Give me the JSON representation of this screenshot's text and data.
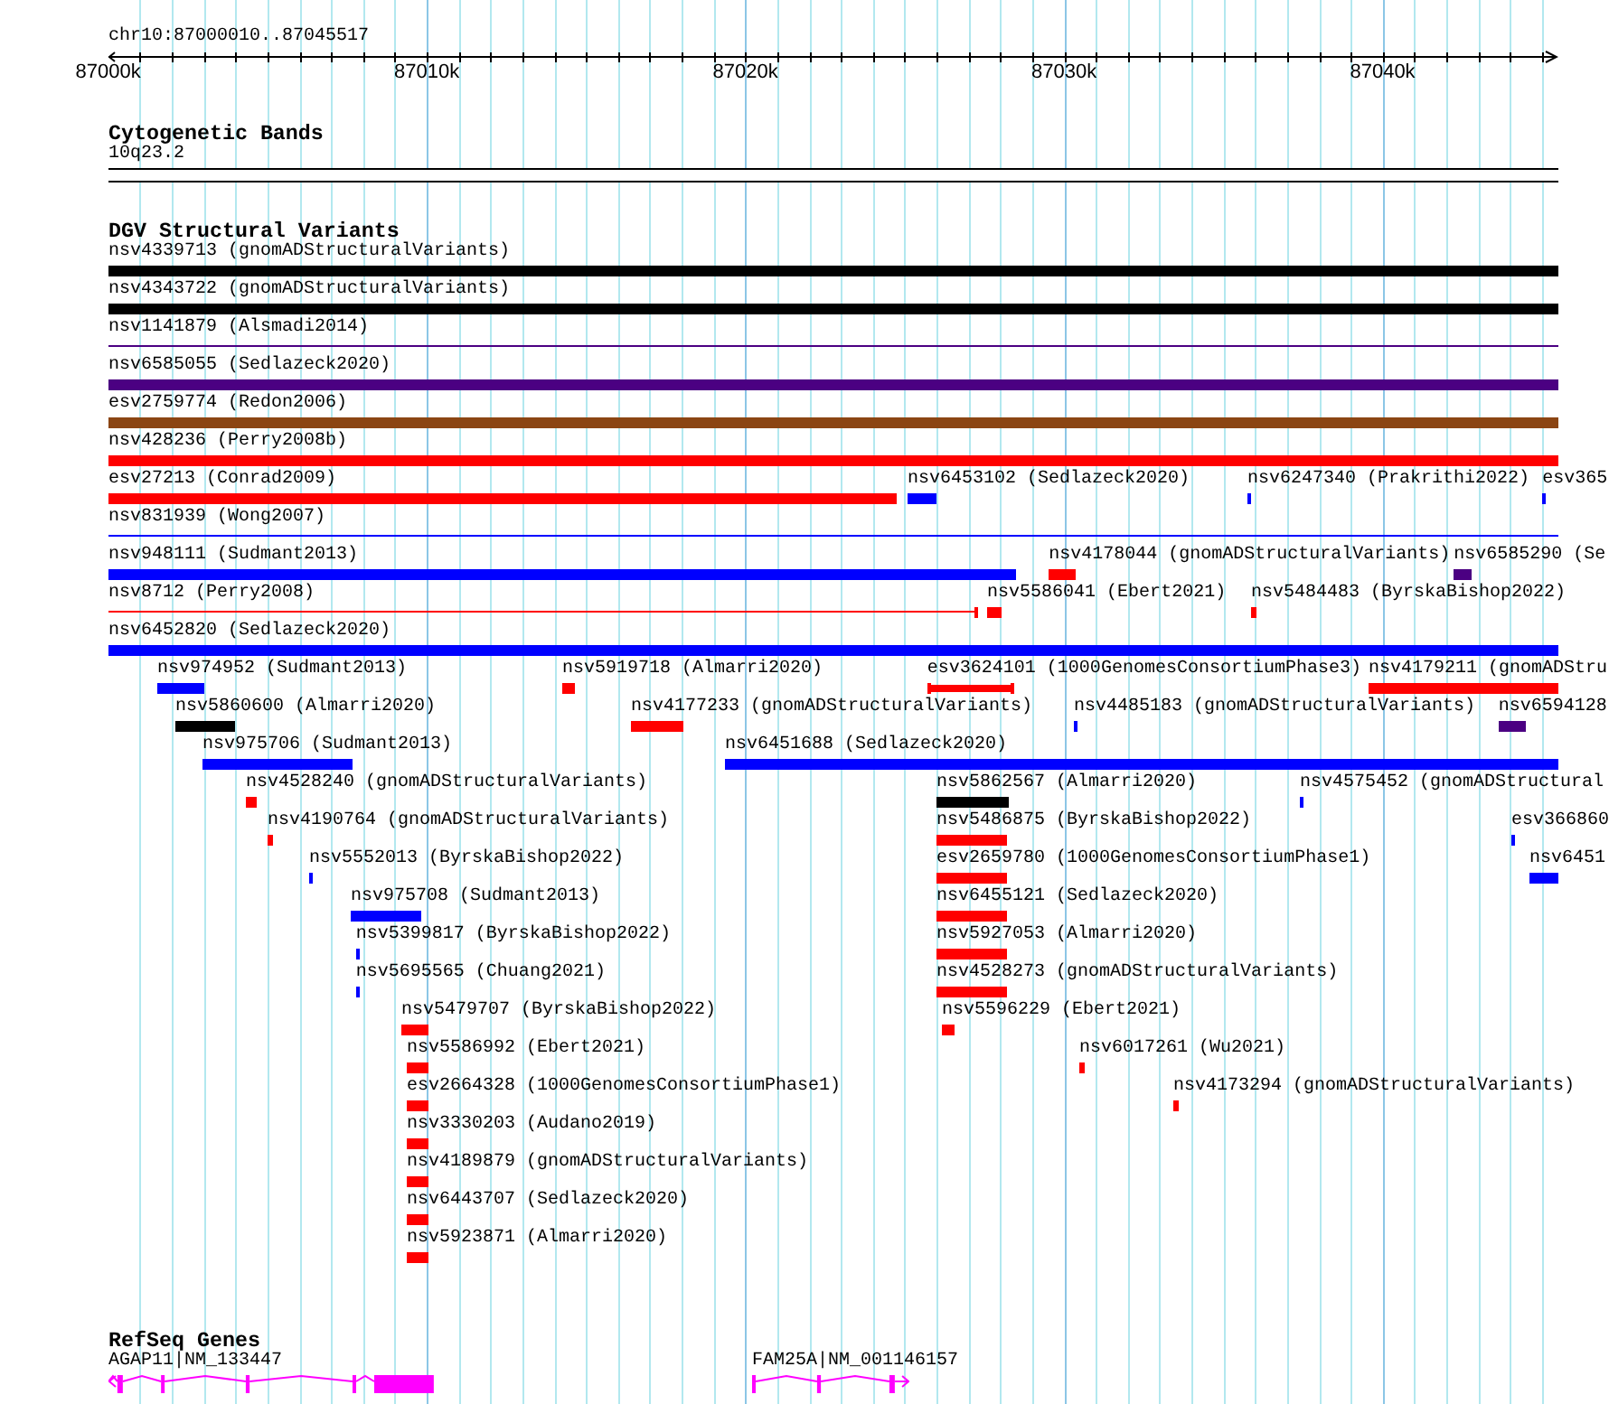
{
  "ruler": {
    "location": "chr10:87000010..87045517",
    "ticks": [
      "87000k",
      "87010k",
      "87020k",
      "87030k",
      "87040k"
    ]
  },
  "tracks": [
    {
      "kind": "cytoband",
      "title": "Cytogenetic Bands",
      "bands": [
        {
          "label": "10q23.2"
        }
      ]
    },
    {
      "kind": "variants",
      "title": "DGV Structural Variants",
      "rows": [
        {
          "features": [
            {
              "label": "nsv4339713 (gnomADStructuralVariants)",
              "color": "#000000",
              "kind": "bar"
            }
          ]
        },
        {
          "features": [
            {
              "label": "nsv4343722 (gnomADStructuralVariants)",
              "color": "#000000",
              "kind": "bar"
            }
          ]
        },
        {
          "features": [
            {
              "label": "nsv1141879 (Alsmadi2014)",
              "color": "#4b0082",
              "kind": "line"
            }
          ]
        },
        {
          "features": [
            {
              "label": "nsv6585055 (Sedlazeck2020)",
              "color": "#4b0082",
              "kind": "bar"
            }
          ]
        },
        {
          "features": [
            {
              "label": "esv2759774 (Redon2006)",
              "color": "#8b4513",
              "kind": "bar"
            }
          ]
        },
        {
          "features": [
            {
              "label": "nsv428236 (Perry2008b)",
              "color": "#ff0000",
              "kind": "bar"
            }
          ]
        },
        {
          "features": [
            {
              "label": "esv27213 (Conrad2009)",
              "color": "#ff0000",
              "kind": "bar"
            },
            {
              "label": "nsv6453102 (Sedlazeck2020)",
              "color": "#0000ff",
              "kind": "bar"
            },
            {
              "label": "nsv6247340 (Prakrithi2022)",
              "color": "#0000ff",
              "kind": "bar"
            },
            {
              "label": "esv365",
              "color": "#0000ff",
              "kind": "bar"
            }
          ]
        },
        {
          "features": [
            {
              "label": "nsv831939 (Wong2007)",
              "color": "#0000ff",
              "kind": "line"
            }
          ]
        },
        {
          "features": [
            {
              "label": "nsv948111 (Sudmant2013)",
              "color": "#0000ff",
              "kind": "bar"
            },
            {
              "label": "nsv4178044 (gnomADStructuralVariants)",
              "color": "#ff0000",
              "kind": "bar"
            },
            {
              "label": "nsv6585290 (Se",
              "color": "#4b0082",
              "kind": "bar"
            }
          ]
        },
        {
          "features": [
            {
              "label": "nsv8712 (Perry2008)",
              "color": "#ff0000",
              "kind": "line"
            },
            {
              "label": "nsv5586041 (Ebert2021)",
              "color": "#ff0000",
              "kind": "bar"
            },
            {
              "label": "nsv5484483 (ByrskaBishop2022)",
              "color": "#ff0000",
              "kind": "bar"
            }
          ]
        },
        {
          "features": [
            {
              "label": "nsv6452820 (Sedlazeck2020)",
              "color": "#0000ff",
              "kind": "bar"
            }
          ]
        },
        {
          "features": [
            {
              "label": "nsv974952 (Sudmant2013)",
              "color": "#0000ff",
              "kind": "bar"
            },
            {
              "label": "nsv5919718 (Almarri2020)",
              "color": "#ff0000",
              "kind": "bar"
            },
            {
              "label": "esv3624101 (1000GenomesConsortiumPhase3)",
              "color": "#ff0000",
              "kind": "capped"
            },
            {
              "label": "nsv4179211 (gnomADStru",
              "color": "#ff0000",
              "kind": "bar"
            }
          ]
        },
        {
          "features": [
            {
              "label": "nsv5860600 (Almarri2020)",
              "color": "#000000",
              "kind": "bar"
            },
            {
              "label": "nsv4177233 (gnomADStructuralVariants)",
              "color": "#ff0000",
              "kind": "bar"
            },
            {
              "label": "nsv4485183 (gnomADStructuralVariants)",
              "color": "#0000ff",
              "kind": "bar"
            },
            {
              "label": "nsv6594128",
              "color": "#4b0082",
              "kind": "bar"
            }
          ]
        },
        {
          "features": [
            {
              "label": "nsv975706 (Sudmant2013)",
              "color": "#0000ff",
              "kind": "bar"
            },
            {
              "label": "nsv6451688 (Sedlazeck2020)",
              "color": "#0000ff",
              "kind": "bar"
            }
          ]
        },
        {
          "features": [
            {
              "label": "nsv4528240 (gnomADStructuralVariants)",
              "color": "#ff0000",
              "kind": "bar"
            },
            {
              "label": "nsv5862567 (Almarri2020)",
              "color": "#000000",
              "kind": "bar"
            },
            {
              "label": "nsv4575452 (gnomADStructural",
              "color": "#0000ff",
              "kind": "bar"
            }
          ]
        },
        {
          "features": [
            {
              "label": "nsv4190764 (gnomADStructuralVariants)",
              "color": "#ff0000",
              "kind": "bar"
            },
            {
              "label": "nsv5486875 (ByrskaBishop2022)",
              "color": "#ff0000",
              "kind": "bar"
            },
            {
              "label": "esv366860",
              "color": "#0000ff",
              "kind": "bar"
            }
          ]
        },
        {
          "features": [
            {
              "label": "nsv5552013 (ByrskaBishop2022)",
              "color": "#0000ff",
              "kind": "bar"
            },
            {
              "label": "esv2659780 (1000GenomesConsortiumPhase1)",
              "color": "#ff0000",
              "kind": "bar"
            },
            {
              "label": "nsv6451",
              "color": "#0000ff",
              "kind": "bar"
            }
          ]
        },
        {
          "features": [
            {
              "label": "nsv975708 (Sudmant2013)",
              "color": "#0000ff",
              "kind": "bar"
            },
            {
              "label": "nsv6455121 (Sedlazeck2020)",
              "color": "#ff0000",
              "kind": "bar"
            }
          ]
        },
        {
          "features": [
            {
              "label": "nsv5399817 (ByrskaBishop2022)",
              "color": "#0000ff",
              "kind": "bar"
            },
            {
              "label": "nsv5927053 (Almarri2020)",
              "color": "#ff0000",
              "kind": "bar"
            }
          ]
        },
        {
          "features": [
            {
              "label": "nsv5695565 (Chuang2021)",
              "color": "#0000ff",
              "kind": "bar"
            },
            {
              "label": "nsv4528273 (gnomADStructuralVariants)",
              "color": "#ff0000",
              "kind": "bar"
            }
          ]
        },
        {
          "features": [
            {
              "label": "nsv5479707 (ByrskaBishop2022)",
              "color": "#ff0000",
              "kind": "bar"
            },
            {
              "label": "nsv5596229 (Ebert2021)",
              "color": "#ff0000",
              "kind": "bar"
            }
          ]
        },
        {
          "features": [
            {
              "label": "nsv5586992 (Ebert2021)",
              "color": "#ff0000",
              "kind": "bar"
            },
            {
              "label": "nsv6017261 (Wu2021)",
              "color": "#ff0000",
              "kind": "bar"
            }
          ]
        },
        {
          "features": [
            {
              "label": "esv2664328 (1000GenomesConsortiumPhase1)",
              "color": "#ff0000",
              "kind": "bar"
            },
            {
              "label": "nsv4173294 (gnomADStructuralVariants)",
              "color": "#ff0000",
              "kind": "bar"
            }
          ]
        },
        {
          "features": [
            {
              "label": "nsv3330203 (Audano2019)",
              "color": "#ff0000",
              "kind": "bar"
            }
          ]
        },
        {
          "features": [
            {
              "label": "nsv4189879 (gnomADStructuralVariants)",
              "color": "#ff0000",
              "kind": "bar"
            }
          ]
        },
        {
          "features": [
            {
              "label": "nsv6443707 (Sedlazeck2020)",
              "color": "#ff0000",
              "kind": "bar"
            }
          ]
        },
        {
          "features": [
            {
              "label": "nsv5923871 (Almarri2020)",
              "color": "#ff0000",
              "kind": "bar"
            }
          ]
        }
      ]
    },
    {
      "kind": "genes",
      "title": "RefSeq Genes",
      "genes": [
        {
          "label": "AGAP11|NM_133447"
        },
        {
          "label": "FAM25A|NM_001146157"
        }
      ]
    }
  ]
}
